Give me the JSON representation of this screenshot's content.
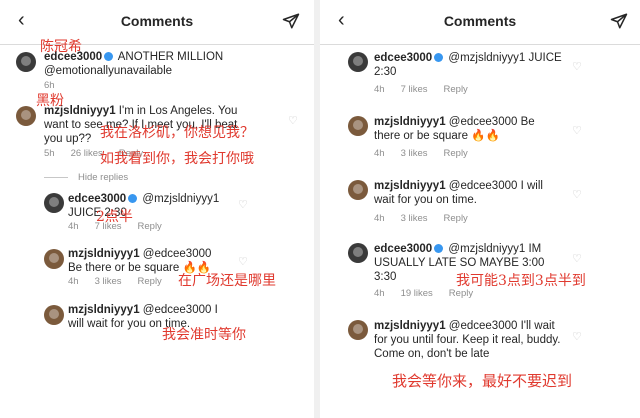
{
  "left": {
    "header": {
      "title": "Comments"
    },
    "caption": {
      "username": "edcee3000",
      "text": "ANOTHER MILLION",
      "tag": "@emotionallyunavailable",
      "time": "6h"
    },
    "comment1": {
      "username": "mzjsldniyyy1",
      "text": "I'm in Los Angeles. You want to see me? If I meet you, I'll beat you up??",
      "time": "5h",
      "likes": "26 likes",
      "reply": "Reply"
    },
    "hide_replies": "Hide replies",
    "reply1": {
      "username": "edcee3000",
      "text": "@mzjsldniyyy1 JUICE 2:30",
      "time": "4h",
      "likes": "7 likes",
      "reply": "Reply"
    },
    "reply2": {
      "username": "mzjsldniyyy1",
      "text": "@edcee3000 Be there or be square",
      "emoji": "🔥🔥",
      "time": "4h",
      "likes": "3 likes",
      "reply": "Reply"
    },
    "reply3": {
      "username": "mzjsldniyyy1",
      "text": "@edcee3000 I will wait for you on time."
    },
    "annotations": {
      "edcee": "陈冠希",
      "mz": "黑粉",
      "la": "我在洛杉矶，你想见我？",
      "beat": "如我看到你，我会打你哦",
      "time230": "2点半",
      "square": "在广场还是哪里",
      "ontime": "我会准时等你"
    }
  },
  "right": {
    "header": {
      "title": "Comments"
    },
    "c1": {
      "username": "edcee3000",
      "text": "@mzjsldniyyy1 JUICE 2:30",
      "time": "4h",
      "likes": "7 likes",
      "reply": "Reply"
    },
    "c2": {
      "username": "mzjsldniyyy1",
      "text": "@edcee3000 Be there or be square",
      "emoji": "🔥🔥",
      "time": "4h",
      "likes": "3 likes",
      "reply": "Reply"
    },
    "c3": {
      "username": "mzjsldniyyy1",
      "text": "@edcee3000 I will wait for you on time.",
      "time": "4h",
      "likes": "3 likes",
      "reply": "Reply"
    },
    "c4": {
      "username": "edcee3000",
      "text": "@mzjsldniyyy1 IM USUALLY LATE SO MAYBE 3:00 3:30",
      "time": "4h",
      "likes": "19 likes",
      "reply": "Reply"
    },
    "c5": {
      "username": "mzjsldniyyy1",
      "text": "@edcee3000 I'll wait for you until four. Keep it real, buddy. Come on, don't be late"
    },
    "annotations": {
      "late": "我可能3点到3点半到",
      "wait": "我会等你来，最好不要迟到"
    }
  },
  "icons": {
    "back": "chevron-left-icon",
    "send": "paper-plane-icon",
    "heart": "heart-outline-icon",
    "verified": "verified-badge-icon"
  }
}
